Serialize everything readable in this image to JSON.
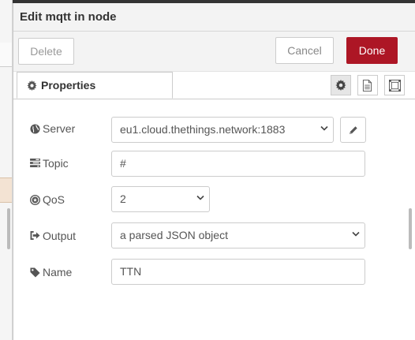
{
  "tray": {
    "title": "Edit mqtt in node",
    "delete_label": "Delete",
    "cancel_label": "Cancel",
    "done_label": "Done"
  },
  "tabs": {
    "properties_label": "Properties"
  },
  "form": {
    "server": {
      "label": "Server",
      "value": "eu1.cloud.thethings.network:1883"
    },
    "topic": {
      "label": "Topic",
      "value": "#"
    },
    "qos": {
      "label": "QoS",
      "value": "2"
    },
    "output": {
      "label": "Output",
      "value": "a parsed JSON object"
    },
    "name": {
      "label": "Name",
      "value": "TTN"
    }
  },
  "colors": {
    "done_button": "#ad1625",
    "header_bg": "#f3f3f3"
  },
  "icons": [
    "cog-icon",
    "globe-icon",
    "tasks-icon",
    "qos-icon",
    "sign-out-icon",
    "tag-icon",
    "pencil-icon",
    "file-text-icon",
    "expand-icon",
    "chevron-down-icon"
  ]
}
